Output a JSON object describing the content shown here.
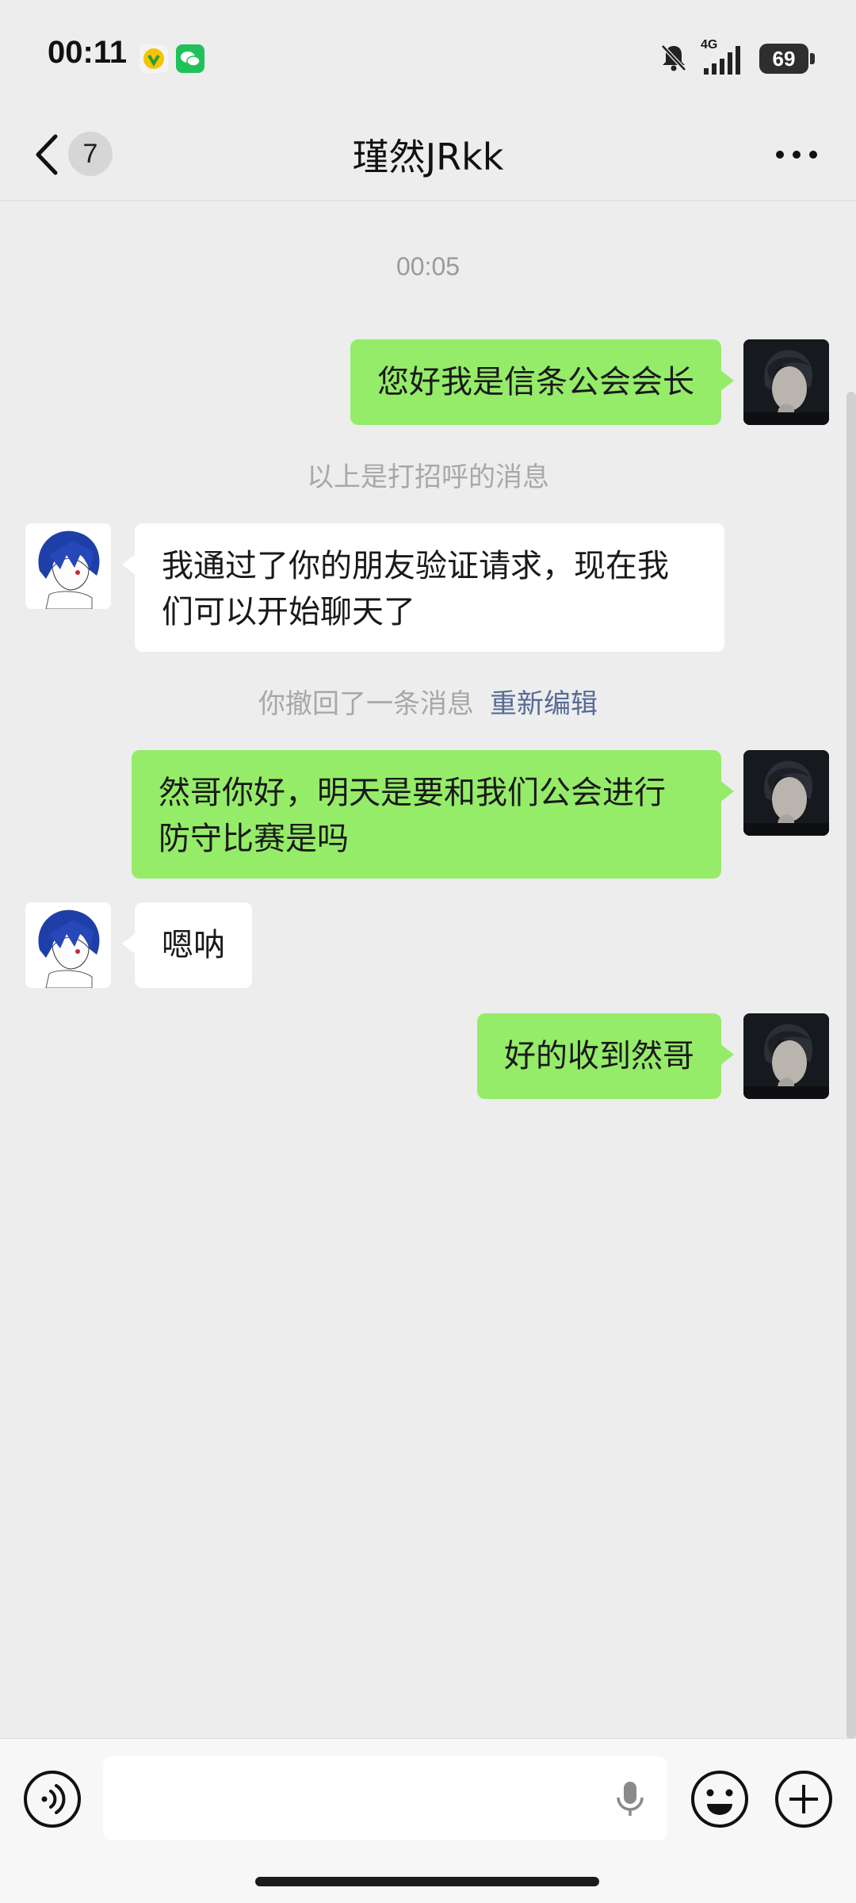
{
  "status_bar": {
    "time": "00:11",
    "battery": "69",
    "network": "4G",
    "icons": [
      "app-notification-icon",
      "wechat-icon",
      "mute-bell-icon",
      "signal-icon",
      "battery-icon"
    ]
  },
  "nav": {
    "title": "瑾然JRkk",
    "unread_badge": "7",
    "back_icon": "chevron-left-icon",
    "more_icon": "more-dots-icon"
  },
  "chat": {
    "timestamp": "00:05",
    "messages": [
      {
        "side": "self",
        "text": "您好我是信条公会会长"
      },
      {
        "side": "system",
        "text": "以上是打招呼的消息"
      },
      {
        "side": "other",
        "text": "我通过了你的朋友验证请求，现在我们可以开始聊天了"
      },
      {
        "side": "system",
        "text": "你撤回了一条消息",
        "link": "重新编辑"
      },
      {
        "side": "self",
        "text": "然哥你好，明天是要和我们公会进行防守比赛是吗"
      },
      {
        "side": "other",
        "text": "嗯呐"
      },
      {
        "side": "self",
        "text": "好的收到然哥"
      }
    ]
  },
  "input_bar": {
    "input_value": "",
    "icons": [
      "voice-mode-icon",
      "microphone-icon",
      "emoji-icon",
      "plus-icon"
    ]
  },
  "colors": {
    "background": "#ededed",
    "self_bubble": "#95ec69",
    "other_bubble": "#ffffff",
    "link": "#576b95"
  }
}
